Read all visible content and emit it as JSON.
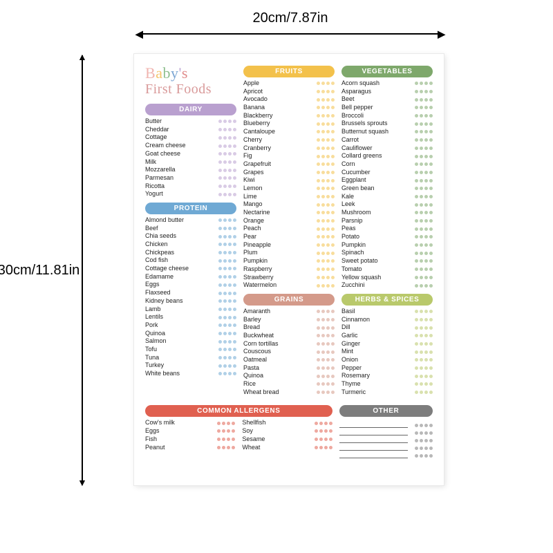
{
  "dimensions": {
    "width_label": "20cm/7.87in",
    "height_label": "30cm/11.81in"
  },
  "title": {
    "word1_letters": [
      "B",
      "a",
      "b",
      "y",
      "'",
      "s"
    ],
    "word1_colors": [
      "#f0b5b0",
      "#f4c56b",
      "#8fbf8f",
      "#7fa8d4",
      "#bda7d4",
      "#e08b8b"
    ],
    "word2": "First Foods",
    "word2_color": "#d99a9a"
  },
  "columns": [
    {
      "sections": [
        {
          "id": "dairy",
          "label": "DAIRY",
          "color": "#b9a0cf",
          "items": [
            "Butter",
            "Cheddar",
            "Cottage",
            "Cream cheese",
            "Goat cheese",
            "Milk",
            "Mozzarella",
            "Parmesan",
            "Ricotta",
            "Yogurt"
          ]
        },
        {
          "id": "protein",
          "label": "PROTEIN",
          "color": "#6fa9d4",
          "items": [
            "Almond butter",
            "Beef",
            "Chia seeds",
            "Chicken",
            "Chickpeas",
            "Cod fish",
            "Cottage cheese",
            "Edamame",
            "Eggs",
            "Flaxseed",
            "Kidney beans",
            "Lamb",
            "Lentils",
            "Pork",
            "Quinoa",
            "Salmon",
            "Tofu",
            "Tuna",
            "Turkey",
            "White beans"
          ]
        }
      ]
    },
    {
      "sections": [
        {
          "id": "fruits",
          "label": "FRUITS",
          "color": "#f3c14b",
          "items": [
            "Apple",
            "Apricot",
            "Avocado",
            "Banana",
            "Blackberry",
            "Blueberry",
            "Cantaloupe",
            "Cherry",
            "Cranberry",
            "Fig",
            "Grapefruit",
            "Grapes",
            "Kiwi",
            "Lemon",
            "Lime",
            "Mango",
            "Nectarine",
            "Orange",
            "Peach",
            "Pear",
            "Pineapple",
            "Plum",
            "Pumpkin",
            "Raspberry",
            "Strawberry",
            "Watermelon"
          ]
        },
        {
          "id": "grains",
          "label": "GRAINS",
          "color": "#d49a8a",
          "items": [
            "Amaranth",
            "Barley",
            "Bread",
            "Buckwheat",
            "Corn tortillas",
            "Couscous",
            "Oatmeal",
            "Pasta",
            "Quinoa",
            "Rice",
            "Wheat bread"
          ]
        }
      ]
    },
    {
      "sections": [
        {
          "id": "vegetables",
          "label": "VEGETABLES",
          "color": "#7ea86b",
          "items": [
            "Acorn squash",
            "Asparagus",
            "Beet",
            "Bell pepper",
            "Broccoli",
            "Brussels sprouts",
            "Butternut squash",
            "Carrot",
            "Cauliflower",
            "Collard greens",
            "Corn",
            "Cucumber",
            "Eggplant",
            "Green bean",
            "Kale",
            "Leek",
            "Mushroom",
            "Parsnip",
            "Peas",
            "Potato",
            "Pumpkin",
            "Spinach",
            "Sweet potato",
            "Tomato",
            "Yellow squash",
            "Zucchini"
          ]
        },
        {
          "id": "herbs",
          "label": "HERBS & SPICES",
          "color": "#b9c96b",
          "items": [
            "Basil",
            "Cinnamon",
            "Dill",
            "Garlic",
            "Ginger",
            "Mint",
            "Onion",
            "Pepper",
            "Rosemary",
            "Thyme",
            "Turmeric"
          ]
        }
      ]
    }
  ],
  "bottom": {
    "allergens": {
      "id": "allergens",
      "label": "COMMON ALLERGENS",
      "color": "#e06050",
      "items": [
        "Cow's milk",
        "Eggs",
        "Fish",
        "Peanut",
        "Shellfish",
        "Soy",
        "Sesame",
        "Wheat"
      ]
    },
    "other": {
      "id": "other",
      "label": "OTHER",
      "color": "#7d7d7d",
      "blank_lines": 5
    }
  },
  "dot_count": 4
}
